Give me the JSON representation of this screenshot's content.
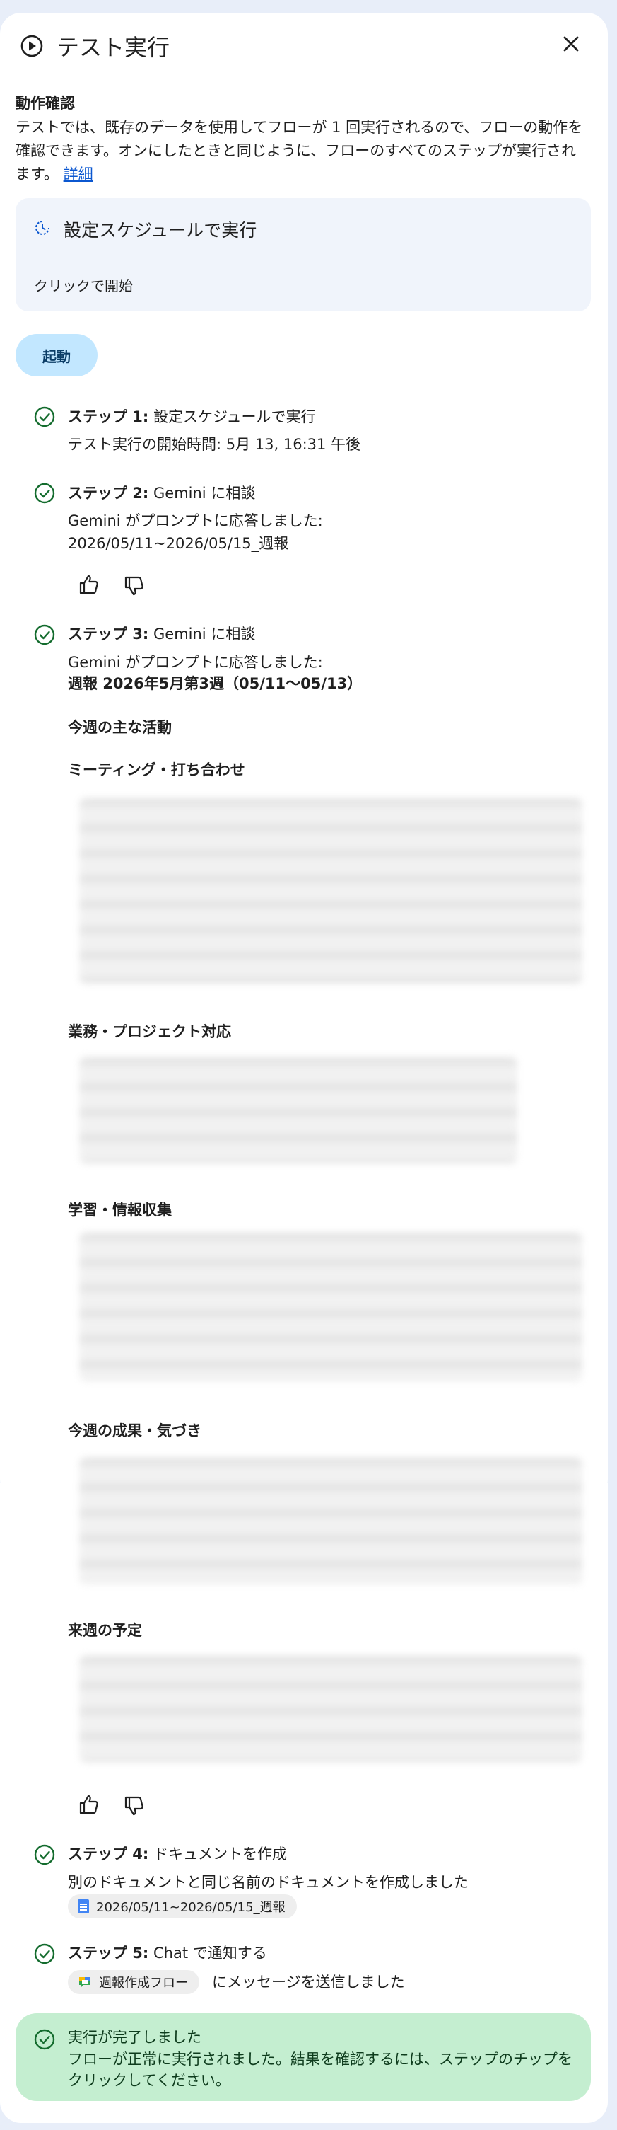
{
  "header": {
    "title": "テスト実行"
  },
  "intro": {
    "section_title": "動作確認",
    "description": "テストでは、既存のデータを使用してフローが 1 回実行されるので、フローの動作を確認できます。オンにしたときと同じように、フローのすべてのステップが実行されます。",
    "details_link": "詳細"
  },
  "trigger": {
    "title": "設定スケジュールで実行",
    "subtitle": "クリックで開始"
  },
  "start_button": "起動",
  "steps": {
    "s1": {
      "label": "ステップ 1:",
      "name": "設定スケジュールで実行",
      "text": "テスト実行の開始時間: 5月 13, 16:31 午後"
    },
    "s2": {
      "label": "ステップ 2:",
      "name": "Gemini に相談",
      "text": "Gemini がプロンプトに応答しました:",
      "result": "2026/05/11~2026/05/15_週報"
    },
    "s3": {
      "label": "ステップ 3:",
      "name": "Gemini に相談",
      "text": "Gemini がプロンプトに応答しました:",
      "result_title": "週報 2026年5月第3週（05/11〜05/13）",
      "sections": {
        "main": "今週の主な活動",
        "meetings": "ミーティング・打ち合わせ",
        "projects": "業務・プロジェクト対応",
        "learning": "学習・情報収集",
        "results": "今週の成果・気づき",
        "next": "来週の予定"
      }
    },
    "s4": {
      "label": "ステップ 4:",
      "name": "ドキュメントを作成",
      "text": "別のドキュメントと同じ名前のドキュメントを作成しました",
      "chip": "2026/05/11~2026/05/15_週報"
    },
    "s5": {
      "label": "ステップ 5:",
      "name": "Chat で通知する",
      "chip": "週報作成フロー",
      "text": "にメッセージを送信しました"
    }
  },
  "completion": {
    "title": "実行が完了しました",
    "text": "フローが正常に実行されました。結果を確認するには、ステップのチップをクリックしてください。"
  },
  "colors": {
    "accent": "#0b57d0",
    "success": "#146c2e",
    "success_bg": "#c4eed0",
    "button_bg": "#c2e7ff"
  }
}
